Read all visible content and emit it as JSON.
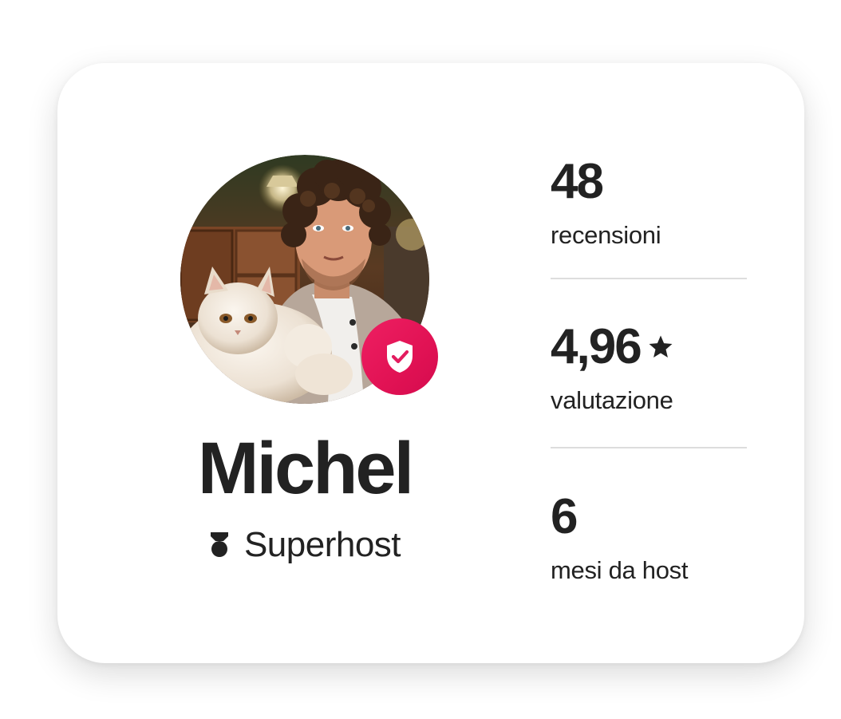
{
  "host": {
    "name": "Michel",
    "status_label": "Superhost",
    "avatar_icon": "host-profile-photo",
    "verified_icon": "shield-check-icon",
    "superhost_icon": "superhost-medal-icon"
  },
  "stats": [
    {
      "value": "48",
      "label": "recensioni"
    },
    {
      "value": "4,96",
      "label": "valutazione",
      "icon": "star-icon"
    },
    {
      "value": "6",
      "label": "mesi da host"
    }
  ],
  "colors": {
    "brand": "#E31C5F",
    "text": "#222222",
    "divider": "#DDDDDD",
    "card_bg": "#FFFFFF"
  }
}
